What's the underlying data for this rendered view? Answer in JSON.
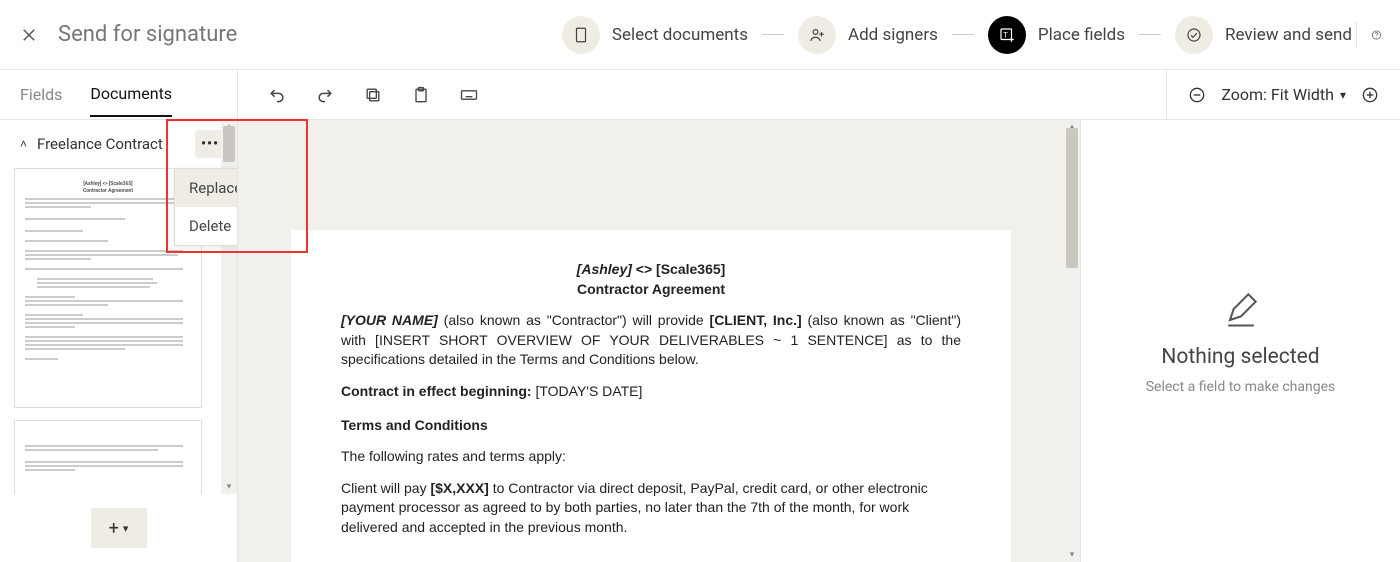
{
  "header": {
    "title": "Send for signature"
  },
  "steps": [
    {
      "label": "Select documents",
      "active": false,
      "icon": "document-icon"
    },
    {
      "label": "Add signers",
      "active": false,
      "icon": "add-signer-icon"
    },
    {
      "label": "Place fields",
      "active": true,
      "icon": "place-fields-icon"
    },
    {
      "label": "Review and send",
      "active": false,
      "icon": "check-icon"
    }
  ],
  "tabs": {
    "fields": "Fields",
    "documents": "Documents"
  },
  "zoom": {
    "label": "Zoom: Fit Width"
  },
  "sidebar": {
    "doc_name": "Freelance Contract",
    "menu": {
      "replace": "Replace",
      "delete": "Delete"
    }
  },
  "doc": {
    "title_line_1_a": "[Ashley]",
    "title_line_1_mid": " <> ",
    "title_line_1_b": "[Scale365]",
    "title_line_2": "Contractor Agreement",
    "intro_a": "[YOUR NAME]",
    "intro_b": " (also known as \"Contractor\") will provide ",
    "intro_c": "[CLIENT, Inc.]",
    "intro_d": " (also known as \"Client\") with [INSERT SHORT OVERVIEW OF YOUR DELIVERABLES ~ 1 SENTENCE] as to the specifications detailed in the Terms and Conditions below.",
    "effect_label": "Contract in effect beginning:",
    "effect_value": "  [TODAY'S DATE]",
    "tc_heading": "Terms and Conditions",
    "rates_line": "The following rates and terms apply:",
    "pay_a": "Client will pay ",
    "pay_b": "[$X,XXX]",
    "pay_c": " to Contractor via direct deposit, PayPal, credit card, or other electronic payment processor as agreed to by both parties, no later than the 7th of the month, for work delivered and accepted in the previous month."
  },
  "right": {
    "title": "Nothing selected",
    "subtitle": "Select a field to make changes"
  }
}
